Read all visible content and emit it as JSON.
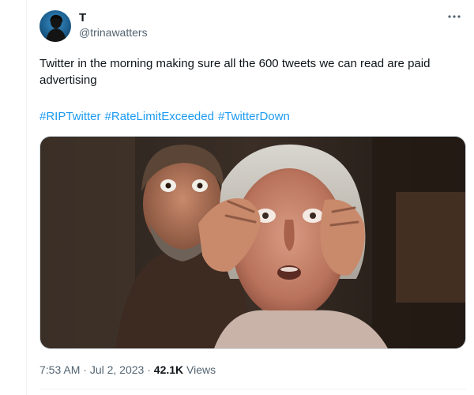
{
  "author": {
    "name": "T",
    "handle": "@trinawatters"
  },
  "tweet": {
    "text": "Twitter in the morning making sure all the 600 tweets we can read are paid advertising",
    "hashtags": [
      "#RIPTwitter",
      "#RateLimitExceeded",
      "#TwitterDown"
    ]
  },
  "media": {
    "description": ""
  },
  "meta": {
    "time": "7:53 AM",
    "separator": "·",
    "date": "Jul 2, 2023",
    "views_count": "42.1K",
    "views_label": "Views"
  },
  "icons": {
    "more": "more-horizontal-icon"
  },
  "colors": {
    "link": "#1d9bf0",
    "secondary_text": "#536471",
    "primary_text": "#0f1419"
  }
}
